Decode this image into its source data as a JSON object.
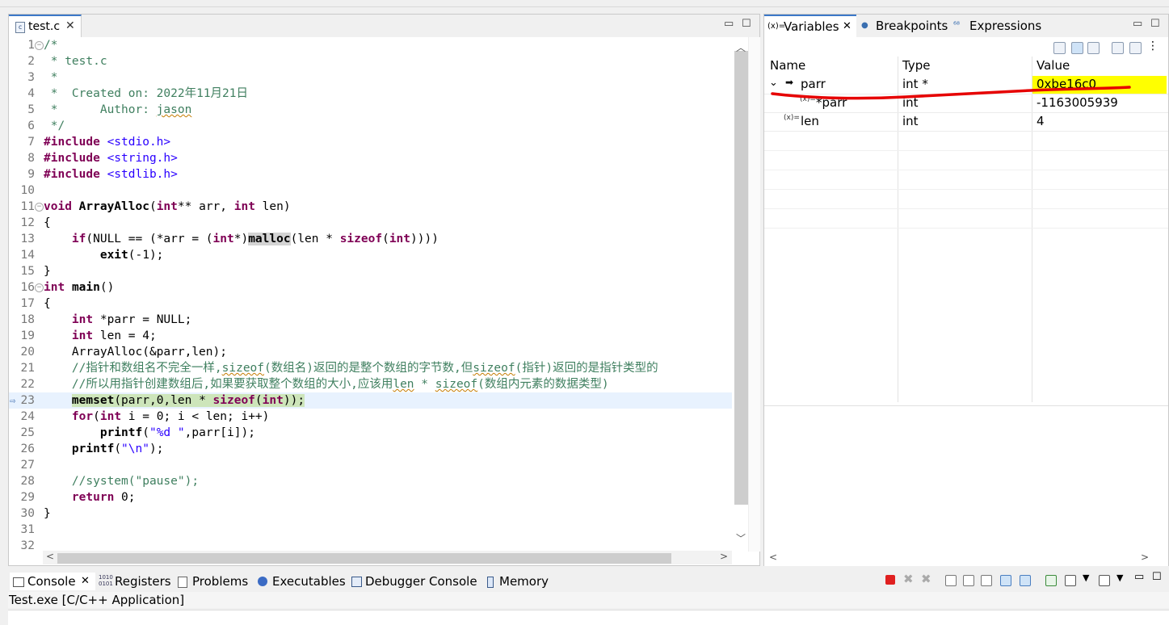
{
  "editor": {
    "tab_label": "test.c",
    "tab_close": "✕",
    "lines": [
      {
        "n": "1",
        "html": "<span class=\"cm\">/*</span>"
      },
      {
        "n": "2",
        "html": "<span class=\"cm\"> * test.c</span>"
      },
      {
        "n": "3",
        "html": "<span class=\"cm\"> *</span>"
      },
      {
        "n": "4",
        "html": "<span class=\"cm\"> *  Created on: 2022年11月21日</span>"
      },
      {
        "n": "5",
        "html": "<span class=\"cm\"> *      Author: <span class=\"squig\">jason</span></span>"
      },
      {
        "n": "6",
        "html": "<span class=\"cm\"> */</span>"
      },
      {
        "n": "7",
        "html": "<span class=\"kw\">#include</span> <span class=\"st\">&lt;stdio.h&gt;</span>"
      },
      {
        "n": "8",
        "html": "<span class=\"kw\">#include</span> <span class=\"st\">&lt;string.h&gt;</span>"
      },
      {
        "n": "9",
        "html": "<span class=\"kw\">#include</span> <span class=\"st\">&lt;stdlib.h&gt;</span>"
      },
      {
        "n": "10",
        "html": ""
      },
      {
        "n": "11",
        "html": "<span class=\"kw\">void</span> <span class=\"fnb\">ArrayAlloc</span>(<span class=\"kw\">int</span>** arr, <span class=\"kw\">int</span> len)"
      },
      {
        "n": "12",
        "html": "{"
      },
      {
        "n": "13",
        "html": "    <span class=\"kw\">if</span>(NULL == (*arr = (<span class=\"kw\">int</span>*)<span class=\"fnb hl-mal\">malloc</span>(len * <span class=\"kw\">sizeof</span>(<span class=\"kw\">int</span>))))"
      },
      {
        "n": "14",
        "html": "        <span class=\"fnb\">exit</span>(-1);"
      },
      {
        "n": "15",
        "html": "}"
      },
      {
        "n": "16",
        "html": "<span class=\"kw\">int</span> <span class=\"fnb\">main</span>()"
      },
      {
        "n": "17",
        "html": "{"
      },
      {
        "n": "18",
        "html": "    <span class=\"kw\">int</span> *parr = NULL;"
      },
      {
        "n": "19",
        "html": "    <span class=\"kw\">int</span> len = 4;"
      },
      {
        "n": "20",
        "html": "    ArrayAlloc(&amp;parr,len);"
      },
      {
        "n": "21",
        "html": "    <span class=\"cm\">//指针和数组名不完全一样,<span class=\"squig\">sizeof</span>(数组名)返回的是整个数组的字节数,但<span class=\"squig\">sizeof</span>(指针)返回的是指针类型的</span>"
      },
      {
        "n": "22",
        "html": "    <span class=\"cm\">//所以用指针创建数组后,如果要获取整个数组的大小,应该用<span class=\"squig\">len</span> * <span class=\"squig\">sizeof</span>(数组内元素的数据类型)</span>"
      },
      {
        "n": "23",
        "html": "    <span class=\"hl-mem\"><span class=\"fnb\">memset</span>(parr,0,len * <span class=\"kw\">sizeof</span>(<span class=\"kw\">int</span>));</span>",
        "current": true
      },
      {
        "n": "24",
        "html": "    <span class=\"kw\">for</span>(<span class=\"kw\">int</span> i = 0; i &lt; len; i++)"
      },
      {
        "n": "25",
        "html": "        <span class=\"fnb\">printf</span>(<span class=\"st\">\"%d \"</span>,parr[i]);"
      },
      {
        "n": "26",
        "html": "    <span class=\"fnb\">printf</span>(<span class=\"st\">\"\\n\"</span>);"
      },
      {
        "n": "27",
        "html": ""
      },
      {
        "n": "28",
        "html": "    <span class=\"cm\">//system(\"pause\");</span>"
      },
      {
        "n": "29",
        "html": "    <span class=\"kw\">return</span> 0;"
      },
      {
        "n": "30",
        "html": "}"
      },
      {
        "n": "31",
        "html": ""
      },
      {
        "n": "32",
        "html": ""
      }
    ]
  },
  "variables_view": {
    "tabs": [
      {
        "icon": "(x)=",
        "label": "Variables",
        "close": "✕"
      },
      {
        "icon": "●",
        "label": "Breakpoints"
      },
      {
        "icon": "⁶⁸",
        "label": "Expressions"
      }
    ],
    "columns": {
      "name": "Name",
      "type": "Type",
      "value": "Value"
    },
    "rows": [
      {
        "expander": "⌄",
        "icon": "➡",
        "name": "parr",
        "type": "int *",
        "value": "0xbe16c0",
        "highlight": true
      },
      {
        "icon": "(x)=",
        "name": "*parr",
        "type": "int",
        "value": "-1163005939"
      },
      {
        "icon": "(x)=",
        "name": "len",
        "type": "int",
        "value": "4"
      }
    ]
  },
  "console_view": {
    "tabs": [
      {
        "label": "Console",
        "close": "✕"
      },
      {
        "label": "Registers"
      },
      {
        "label": "Problems"
      },
      {
        "label": "Executables"
      },
      {
        "label": "Debugger Console"
      },
      {
        "label": "Memory"
      }
    ],
    "process_label": "Test.exe [C/C++ Application]"
  }
}
